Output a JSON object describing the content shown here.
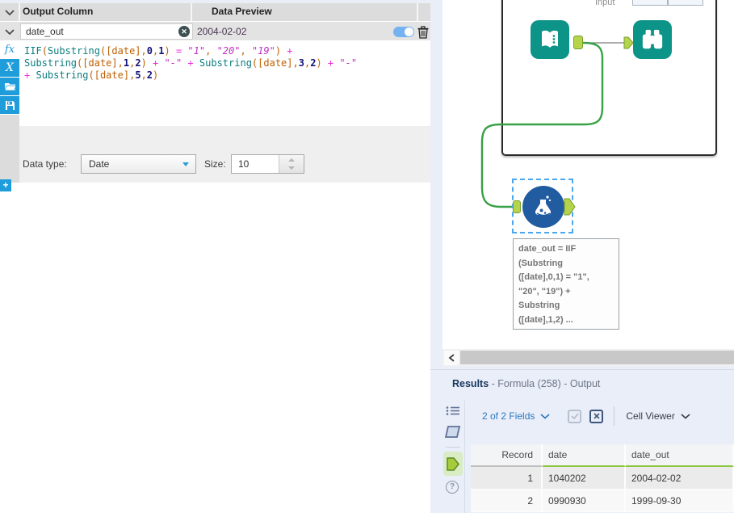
{
  "config_panel": {
    "header": {
      "output_column": "Output Column",
      "data_preview": "Data Preview"
    },
    "expression": {
      "name": "date_out",
      "preview": "2004-02-02",
      "enabled": true
    },
    "editor_toolbar": {
      "functions_label": "fx",
      "variables_label": "X"
    },
    "formula": {
      "lines": [
        [
          {
            "t": "IIF",
            "c": "fn"
          },
          {
            "t": "(",
            "c": "pn"
          },
          {
            "t": "Substring",
            "c": "fn"
          },
          {
            "t": "(",
            "c": "pn"
          },
          {
            "t": "[date]",
            "c": "fd"
          },
          {
            "t": ",",
            "c": "pn"
          },
          {
            "t": "0",
            "c": "nm"
          },
          {
            "t": ",",
            "c": "pn"
          },
          {
            "t": "1",
            "c": "nm"
          },
          {
            "t": ")",
            "c": "pn"
          },
          {
            "t": " ",
            "c": "tx"
          },
          {
            "t": "=",
            "c": "op"
          },
          {
            "t": " ",
            "c": "tx"
          },
          {
            "t": "\"1\"",
            "c": "st"
          },
          {
            "t": ", ",
            "c": "pn"
          },
          {
            "t": "\"20\"",
            "c": "st"
          },
          {
            "t": ", ",
            "c": "pn"
          },
          {
            "t": "\"19\"",
            "c": "st"
          },
          {
            "t": ")",
            "c": "pn"
          },
          {
            "t": " ",
            "c": "tx"
          },
          {
            "t": "+",
            "c": "op"
          }
        ],
        [
          {
            "t": "Substring",
            "c": "fn"
          },
          {
            "t": "(",
            "c": "pn"
          },
          {
            "t": "[date]",
            "c": "fd"
          },
          {
            "t": ",",
            "c": "pn"
          },
          {
            "t": "1",
            "c": "nm"
          },
          {
            "t": ",",
            "c": "pn"
          },
          {
            "t": "2",
            "c": "nm"
          },
          {
            "t": ")",
            "c": "pn"
          },
          {
            "t": " ",
            "c": "tx"
          },
          {
            "t": "+",
            "c": "op"
          },
          {
            "t": " ",
            "c": "tx"
          },
          {
            "t": "\"-\"",
            "c": "st"
          },
          {
            "t": " ",
            "c": "tx"
          },
          {
            "t": "+",
            "c": "op"
          },
          {
            "t": " ",
            "c": "tx"
          },
          {
            "t": "Substring",
            "c": "fn"
          },
          {
            "t": "(",
            "c": "pn"
          },
          {
            "t": "[date]",
            "c": "fd"
          },
          {
            "t": ",",
            "c": "pn"
          },
          {
            "t": "3",
            "c": "nm"
          },
          {
            "t": ",",
            "c": "pn"
          },
          {
            "t": "2",
            "c": "nm"
          },
          {
            "t": ")",
            "c": "pn"
          },
          {
            "t": " ",
            "c": "tx"
          },
          {
            "t": "+",
            "c": "op"
          },
          {
            "t": " ",
            "c": "tx"
          },
          {
            "t": "\"-\"",
            "c": "st"
          }
        ],
        [
          {
            "t": "+",
            "c": "op"
          },
          {
            "t": " ",
            "c": "tx"
          },
          {
            "t": "Substring",
            "c": "fn"
          },
          {
            "t": "(",
            "c": "pn"
          },
          {
            "t": "[date]",
            "c": "fd"
          },
          {
            "t": ",",
            "c": "pn"
          },
          {
            "t": "5",
            "c": "nm"
          },
          {
            "t": ",",
            "c": "pn"
          },
          {
            "t": "2",
            "c": "nm"
          },
          {
            "t": ")",
            "c": "pn"
          }
        ]
      ]
    },
    "data_type_label": "Data type:",
    "data_type_value": "Date",
    "size_label": "Size:",
    "size_value": "10",
    "add_button_label": "+"
  },
  "canvas": {
    "container_label": "Input",
    "tools": [
      {
        "icon": "input-data-book-icon"
      },
      {
        "icon": "browse-binoculars-icon"
      },
      {
        "icon": "formula-flask-icon"
      }
    ],
    "annotation_lines": [
      "date_out = IIF",
      "(Substring",
      "([date],0,1) = \"1\",",
      "\"20\", \"19\") +",
      "Substring",
      "([date],1,2) ..."
    ]
  },
  "results": {
    "title": "Results",
    "subtitle": " - Formula (258) - Output",
    "fields_label": "2 of 2 Fields",
    "cell_viewer_label": "Cell Viewer",
    "help_label": "?",
    "table": {
      "columns": [
        "Record",
        "date",
        "date_out"
      ],
      "rows": [
        [
          "1",
          "1040202",
          "2004-02-02"
        ],
        [
          "2",
          "0990930",
          "1999-09-30"
        ]
      ]
    }
  },
  "colors": {
    "accent_blue": "#1f9ddb",
    "tool_teal": "#0d9488",
    "wire_green": "#38a046",
    "anchor_green": "#b5d44c",
    "formula_blue": "#205c9f",
    "table_underline_green": "#8dc63f"
  }
}
